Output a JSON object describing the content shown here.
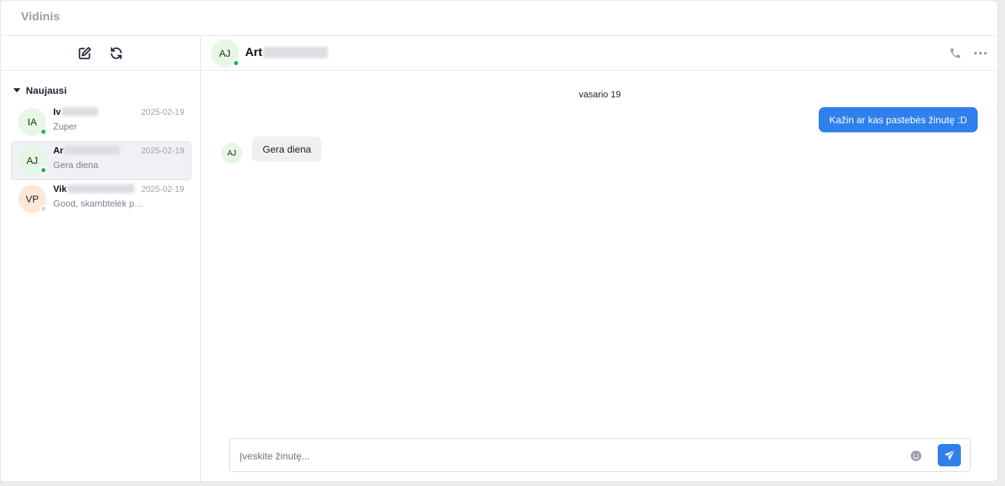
{
  "app": {
    "title": "Vidinis"
  },
  "sidebar": {
    "section_label": "Naujausi",
    "conversations": [
      {
        "initials": "IA",
        "name": "Iv",
        "date": "2025-02-19",
        "preview": "Zuper",
        "online": true,
        "avatar_bg": "#e6f7e4"
      },
      {
        "initials": "AJ",
        "name": "Ar",
        "date": "2025-02-19",
        "preview": "Gera diena",
        "online": true,
        "avatar_bg": "#e6f7e4",
        "active": true
      },
      {
        "initials": "VP",
        "name": "Vik",
        "date": "2025-02-19",
        "preview": "Good, skambtelėk p…",
        "online": false,
        "avatar_bg": "#fde8d7"
      }
    ]
  },
  "chat": {
    "initials": "AJ",
    "title": "Art",
    "day_separator": "vasario 19",
    "outgoing_message": "Kažin ar kas pastebės žinutę :D",
    "incoming_initials": "AJ",
    "incoming_message": "Gera diena"
  },
  "composer": {
    "placeholder": "Įveskite žinutę..."
  },
  "colors": {
    "accent": "#2f80ed",
    "online": "#22b35e",
    "offline": "#d5d8de"
  }
}
